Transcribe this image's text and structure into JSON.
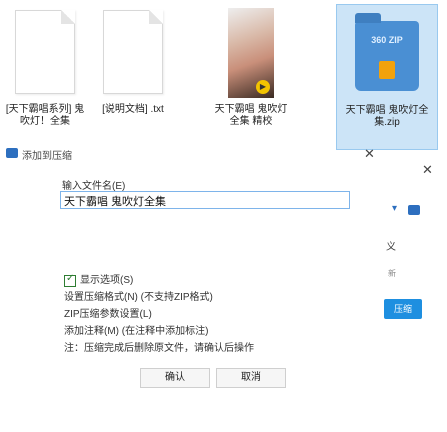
{
  "files": [
    {
      "name": "[天下霸唱系列] 鬼吹灯！全集",
      "kind": "txt-document"
    },
    {
      "name": "[说明文档] .txt",
      "kind": "txt-document"
    },
    {
      "name": "天下霸唱 鬼吹灯全集 精校",
      "kind": "photo"
    },
    {
      "name": "天下霸唱 鬼吹灯全集.zip",
      "kind": "zip-archive"
    }
  ],
  "zip_icon_text": "360 ZIP",
  "breadcrumb": "添加到压缩",
  "dialog": {
    "name_label": "输入文件名(E)",
    "filename_value": "天下霸唱 鬼吹灯全集",
    "right_glyph": "义",
    "right_small": "新",
    "blue_button": "压缩",
    "options": [
      {
        "label": "显示选项(S)",
        "checked": true
      },
      {
        "label": "设置压缩格式(N) (不支持ZIP格式)"
      },
      {
        "label": "ZIP压缩参数设置(L)"
      },
      {
        "label": "添加注释(M) (在注释中添加标注)"
      },
      {
        "label": "注：压缩完成后删除原文件，请确认后操作"
      }
    ],
    "ok_label": "确认",
    "cancel_label": "取消"
  }
}
